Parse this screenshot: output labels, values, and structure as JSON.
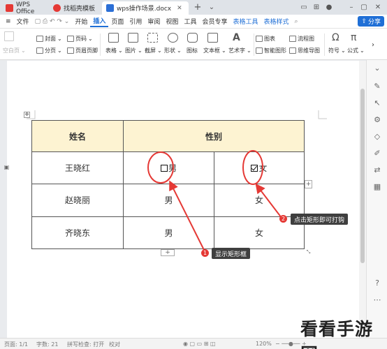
{
  "tabs": [
    {
      "label": "WPS Office",
      "color": "#e53935"
    },
    {
      "label": "找稻壳模板",
      "color": "#e53935"
    },
    {
      "label": "wps操作场景.docx",
      "color": "#2b6fd6"
    }
  ],
  "new_tab_label": "+",
  "menu": {
    "file": "文件",
    "items": [
      "开始",
      "插入",
      "页面",
      "引用",
      "审阅",
      "视图",
      "工具",
      "会员专享"
    ],
    "active": "插入",
    "tools": [
      "表格工具",
      "表格样式"
    ],
    "share": "分享"
  },
  "ribbon": {
    "blank_page": "空白页",
    "cover": "封面",
    "page_break": "分页",
    "page_number": "页码",
    "header_footer": "页眉页脚",
    "table": "表格",
    "picture": "图片",
    "screenshot": "截屏",
    "shape": "形状",
    "icon": "图标",
    "textbox": "文本框",
    "wordart": "艺术字",
    "chart": "图表",
    "smart_shape": "智能图形",
    "flowchart": "流程图",
    "mindmap": "思维导图",
    "symbol": "符号",
    "formula": "公式"
  },
  "table": {
    "headers": [
      "姓名",
      "性别"
    ],
    "rows": [
      {
        "name": "王晓红",
        "opt1": "男",
        "opt2": "女"
      },
      {
        "name": "赵晓丽",
        "opt1": "男",
        "opt2": "女"
      },
      {
        "name": "齐晓东",
        "opt1": "男",
        "opt2": "女"
      }
    ]
  },
  "annotations": {
    "step1": {
      "num": "1",
      "text": "显示矩形框"
    },
    "step2": {
      "num": "2",
      "text": "点击矩形即可打钩"
    },
    "color": "#e53935"
  },
  "status": {
    "page": "页面: 1/1",
    "words": "字数: 21",
    "spellcheck": "拼写检查: 打开",
    "proofread": "校对",
    "zoom": "120%"
  },
  "watermark": "看看手游网"
}
